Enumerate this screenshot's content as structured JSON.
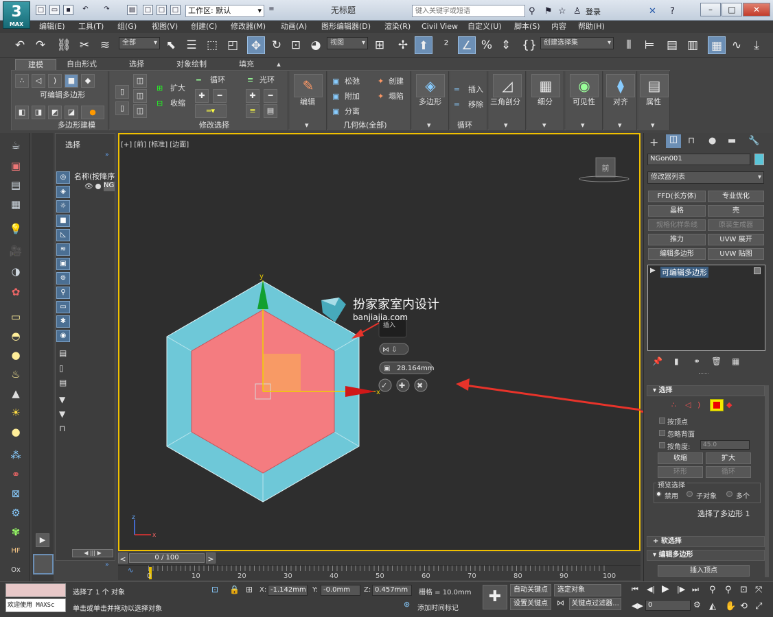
{
  "app": {
    "logo_main": "3",
    "logo_sub": "MAX",
    "workspace": "工作区: 默认",
    "document_title": "无标题",
    "search_placeholder": "键入关键字或短语",
    "login": "登录"
  },
  "menus": [
    "编辑(E)",
    "工具(T)",
    "组(G)",
    "视图(V)",
    "创建(C)",
    "修改器(M)",
    "动画(A)",
    "图形编辑器(D)",
    "渲染(R)",
    "Civil View",
    "自定义(U)",
    "脚本(S)",
    "内容",
    "帮助(H)"
  ],
  "toolbar": {
    "selection_filter": "全部",
    "reference_coord": "视图",
    "named_selection": "创建选择集"
  },
  "ribbon": {
    "tabs": [
      "建模",
      "自由形式",
      "选择",
      "对象绘制",
      "填充"
    ],
    "editable_poly": "可编辑多边形",
    "poly_modeling": "多边形建模",
    "grow": "扩大",
    "shrink": "收缩",
    "loop": "循环",
    "ring": "光环",
    "modify_selection": "修改选择",
    "edit": "编辑",
    "relax": "松弛",
    "attach": "附加",
    "detach": "分离",
    "create": "创建",
    "collapse": "塌陷",
    "geometry_all": "几何体(全部)",
    "polygons": "多边形",
    "insert": "插入",
    "remove": "移除",
    "loops": "循环",
    "triangulate": "三角剖分",
    "subdivision": "细分",
    "visibility": "可见性",
    "align": "对齐",
    "properties": "属性"
  },
  "explorer": {
    "title": "选择",
    "column": "名称(按降序",
    "item": "NG"
  },
  "viewport": {
    "label": "[+] [前] [标准] [边面]",
    "viewcube": "前",
    "watermark_title": "扮家家室内设计",
    "watermark_url": "banjiajia.com",
    "caddy_title": "插入",
    "caddy_value": "28.164mm",
    "axis_y": "y",
    "axis_x": "x",
    "axis_z": "z",
    "axis_x2": "x"
  },
  "timeline": {
    "frame": "0 / 100",
    "ticks": [
      "0",
      "10",
      "20",
      "30",
      "40",
      "50",
      "60",
      "70",
      "80",
      "90",
      "100"
    ]
  },
  "command_panel": {
    "object_name": "NGon001",
    "object_color": "#5bc5d8",
    "modifier_list": "修改器列表",
    "modifier_buttons": [
      {
        "label": "FFD(长方体)",
        "enabled": true
      },
      {
        "label": "专业优化",
        "enabled": true
      },
      {
        "label": "晶格",
        "enabled": true
      },
      {
        "label": "壳",
        "enabled": true
      },
      {
        "label": "规格化样条线",
        "enabled": false
      },
      {
        "label": "原装生成器",
        "enabled": false
      },
      {
        "label": "推力",
        "enabled": true
      },
      {
        "label": "UVW 展开",
        "enabled": true
      },
      {
        "label": "编辑多边形",
        "enabled": true
      },
      {
        "label": "UVW 贴图",
        "enabled": true
      }
    ],
    "stack_item": "可编辑多边形",
    "selection_rollout": "选择",
    "by_vertex": "按顶点",
    "ignore_backfacing": "忽略背面",
    "by_angle": "按角度:",
    "angle_value": "45.0",
    "shrink": "收缩",
    "grow": "扩大",
    "ring": "环形",
    "loop": "循环",
    "preview_selection": "预览选择",
    "preview_options": [
      "禁用",
      "子对象",
      "多个"
    ],
    "selected_info": "选择了多边形 1",
    "soft_selection": "软选择",
    "edit_polygons": "编辑多边形",
    "insert_vertex": "插入顶点"
  },
  "status": {
    "maxscript": "欢迎使用 MAXSc",
    "selected": "选择了 1 个 对象",
    "prompt": "单击或单击并拖动以选择对象",
    "x_label": "X:",
    "x": "-1.142mm",
    "y_label": "Y:",
    "y": "-0.0mm",
    "z_label": "Z:",
    "z": "0.457mm",
    "grid": "栅格 = 10.0mm",
    "add_time_tag": "添加时间标记",
    "auto_key": "自动关键点",
    "set_key": "设置关键点",
    "selected_obj": "选定对象",
    "key_filters": "关键点过滤器...",
    "frame": "0"
  },
  "colors": {
    "inner_face": "#f47c80",
    "outer_ring": "#6ec8d8",
    "selection_border": "#f0c000",
    "arrow": "#e8332a"
  }
}
